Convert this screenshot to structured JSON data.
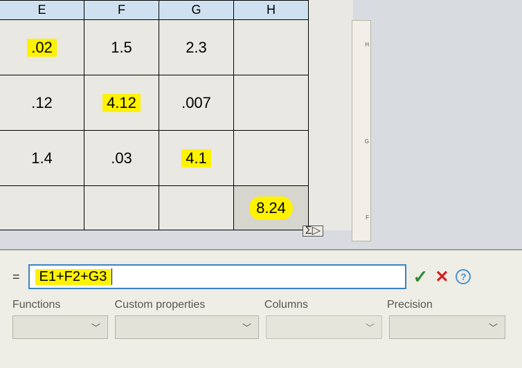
{
  "columns": {
    "E": "E",
    "F": "F",
    "G": "G",
    "H": "H"
  },
  "cells": {
    "E1": ".02",
    "F1": "1.5",
    "G1": "2.3",
    "H1": "",
    "E2": ".12",
    "F2": "4.12",
    "G2": ".007",
    "H2": "",
    "E3": "1.4",
    "F3": ".03",
    "G3": "4.1",
    "H3": "",
    "E4": "",
    "F4": "",
    "G4": "",
    "H4": "8.24"
  },
  "highlighted": [
    "E1",
    "F2",
    "G3",
    "H4"
  ],
  "formula": {
    "equals": "=",
    "value": "E1+F2+G3"
  },
  "panel_labels": {
    "functions": "Functions",
    "custom_props": "Custom properties",
    "columns": "Columns",
    "precision": "Precision"
  },
  "icons": {
    "sigma": "Σ▷",
    "check": "✓",
    "cross": "✕",
    "help": "?",
    "chevron": "﹀"
  }
}
